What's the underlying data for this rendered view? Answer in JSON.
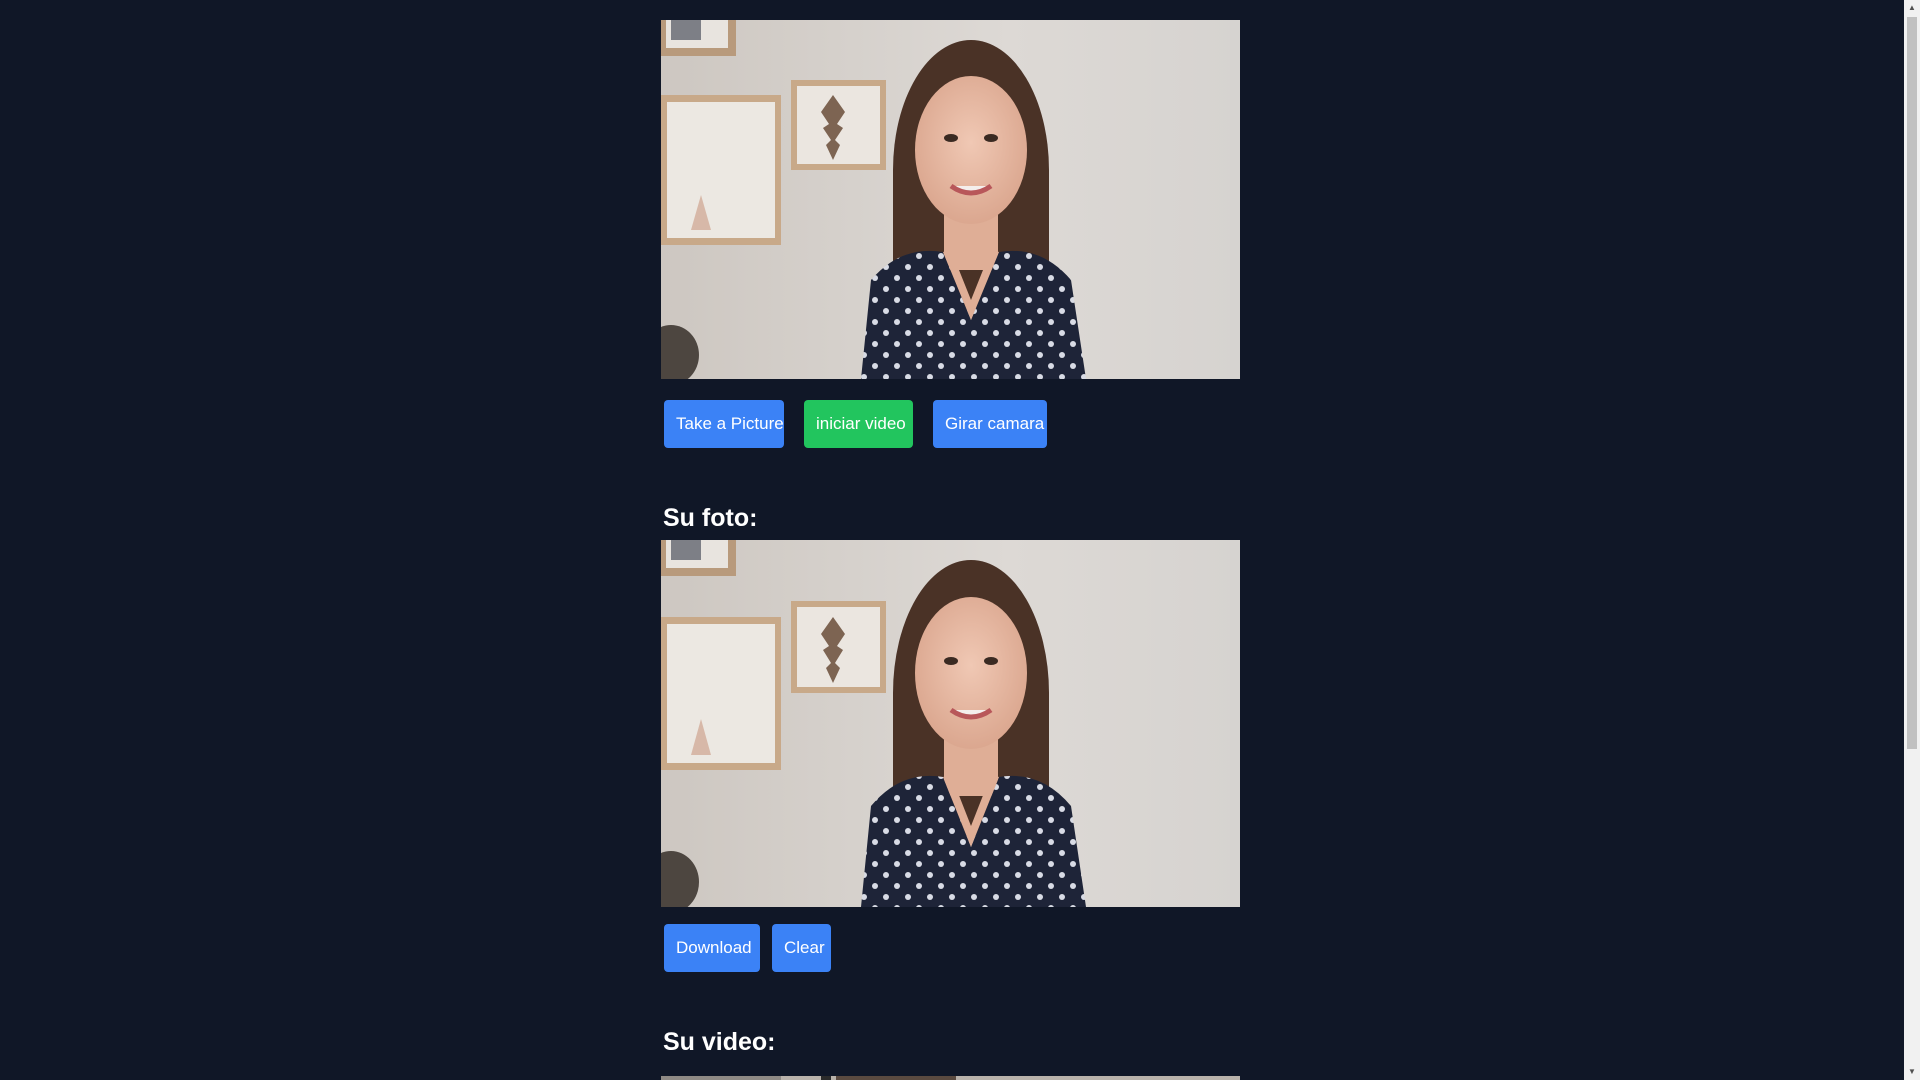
{
  "camera": {
    "buttons": {
      "take_picture": "Take a Picture",
      "start_video": "iniciar video",
      "rotate_camera": "Girar camara"
    }
  },
  "photo_section": {
    "heading": "Su foto:",
    "buttons": {
      "download": "Download",
      "clear": "Clear"
    }
  },
  "video_section": {
    "heading": "Su video:"
  },
  "colors": {
    "background": "#101727",
    "primary_button": "#3b82f6",
    "success_button": "#22c55e",
    "text": "#ffffff"
  },
  "icons": {
    "scroll_up": "scroll-up-arrow-icon",
    "scroll_down": "scroll-down-arrow-icon"
  }
}
